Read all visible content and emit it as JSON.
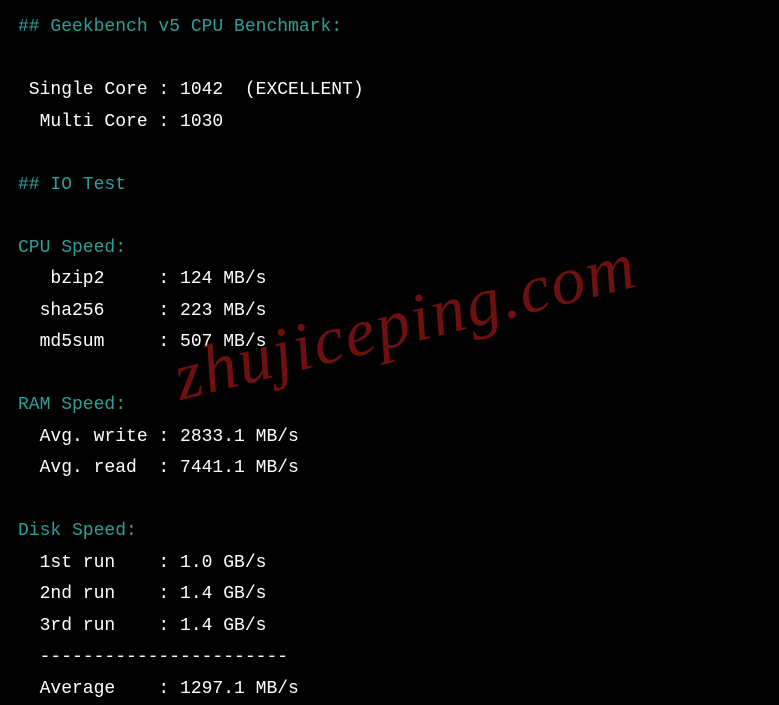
{
  "colors": {
    "heading": "#2aa198",
    "text": "#ffffff",
    "bg": "#000000",
    "watermark": "rgba(200,30,30,0.55)"
  },
  "watermark": "zhujiceping.com",
  "sections": {
    "geekbench": {
      "heading": "## Geekbench v5 CPU Benchmark:",
      "single_core_label": " Single Core : ",
      "single_core_value": "1042  (EXCELLENT)",
      "multi_core_label": "  Multi Core : ",
      "multi_core_value": "1030"
    },
    "io": {
      "heading": "## IO Test"
    },
    "cpu": {
      "heading": "CPU Speed:",
      "rows": [
        {
          "label": "   bzip2     : ",
          "value": "124 MB/s"
        },
        {
          "label": "  sha256     : ",
          "value": "223 MB/s"
        },
        {
          "label": "  md5sum     : ",
          "value": "507 MB/s"
        }
      ]
    },
    "ram": {
      "heading": "RAM Speed:",
      "rows": [
        {
          "label": "  Avg. write : ",
          "value": "2833.1 MB/s"
        },
        {
          "label": "  Avg. read  : ",
          "value": "7441.1 MB/s"
        }
      ]
    },
    "disk": {
      "heading": "Disk Speed:",
      "rows": [
        {
          "label": "  1st run    : ",
          "value": "1.0 GB/s"
        },
        {
          "label": "  2nd run    : ",
          "value": "1.4 GB/s"
        },
        {
          "label": "  3rd run    : ",
          "value": "1.4 GB/s"
        }
      ],
      "divider": "  -----------------------",
      "avg_label": "  Average    : ",
      "avg_value": "1297.1 MB/s"
    }
  }
}
